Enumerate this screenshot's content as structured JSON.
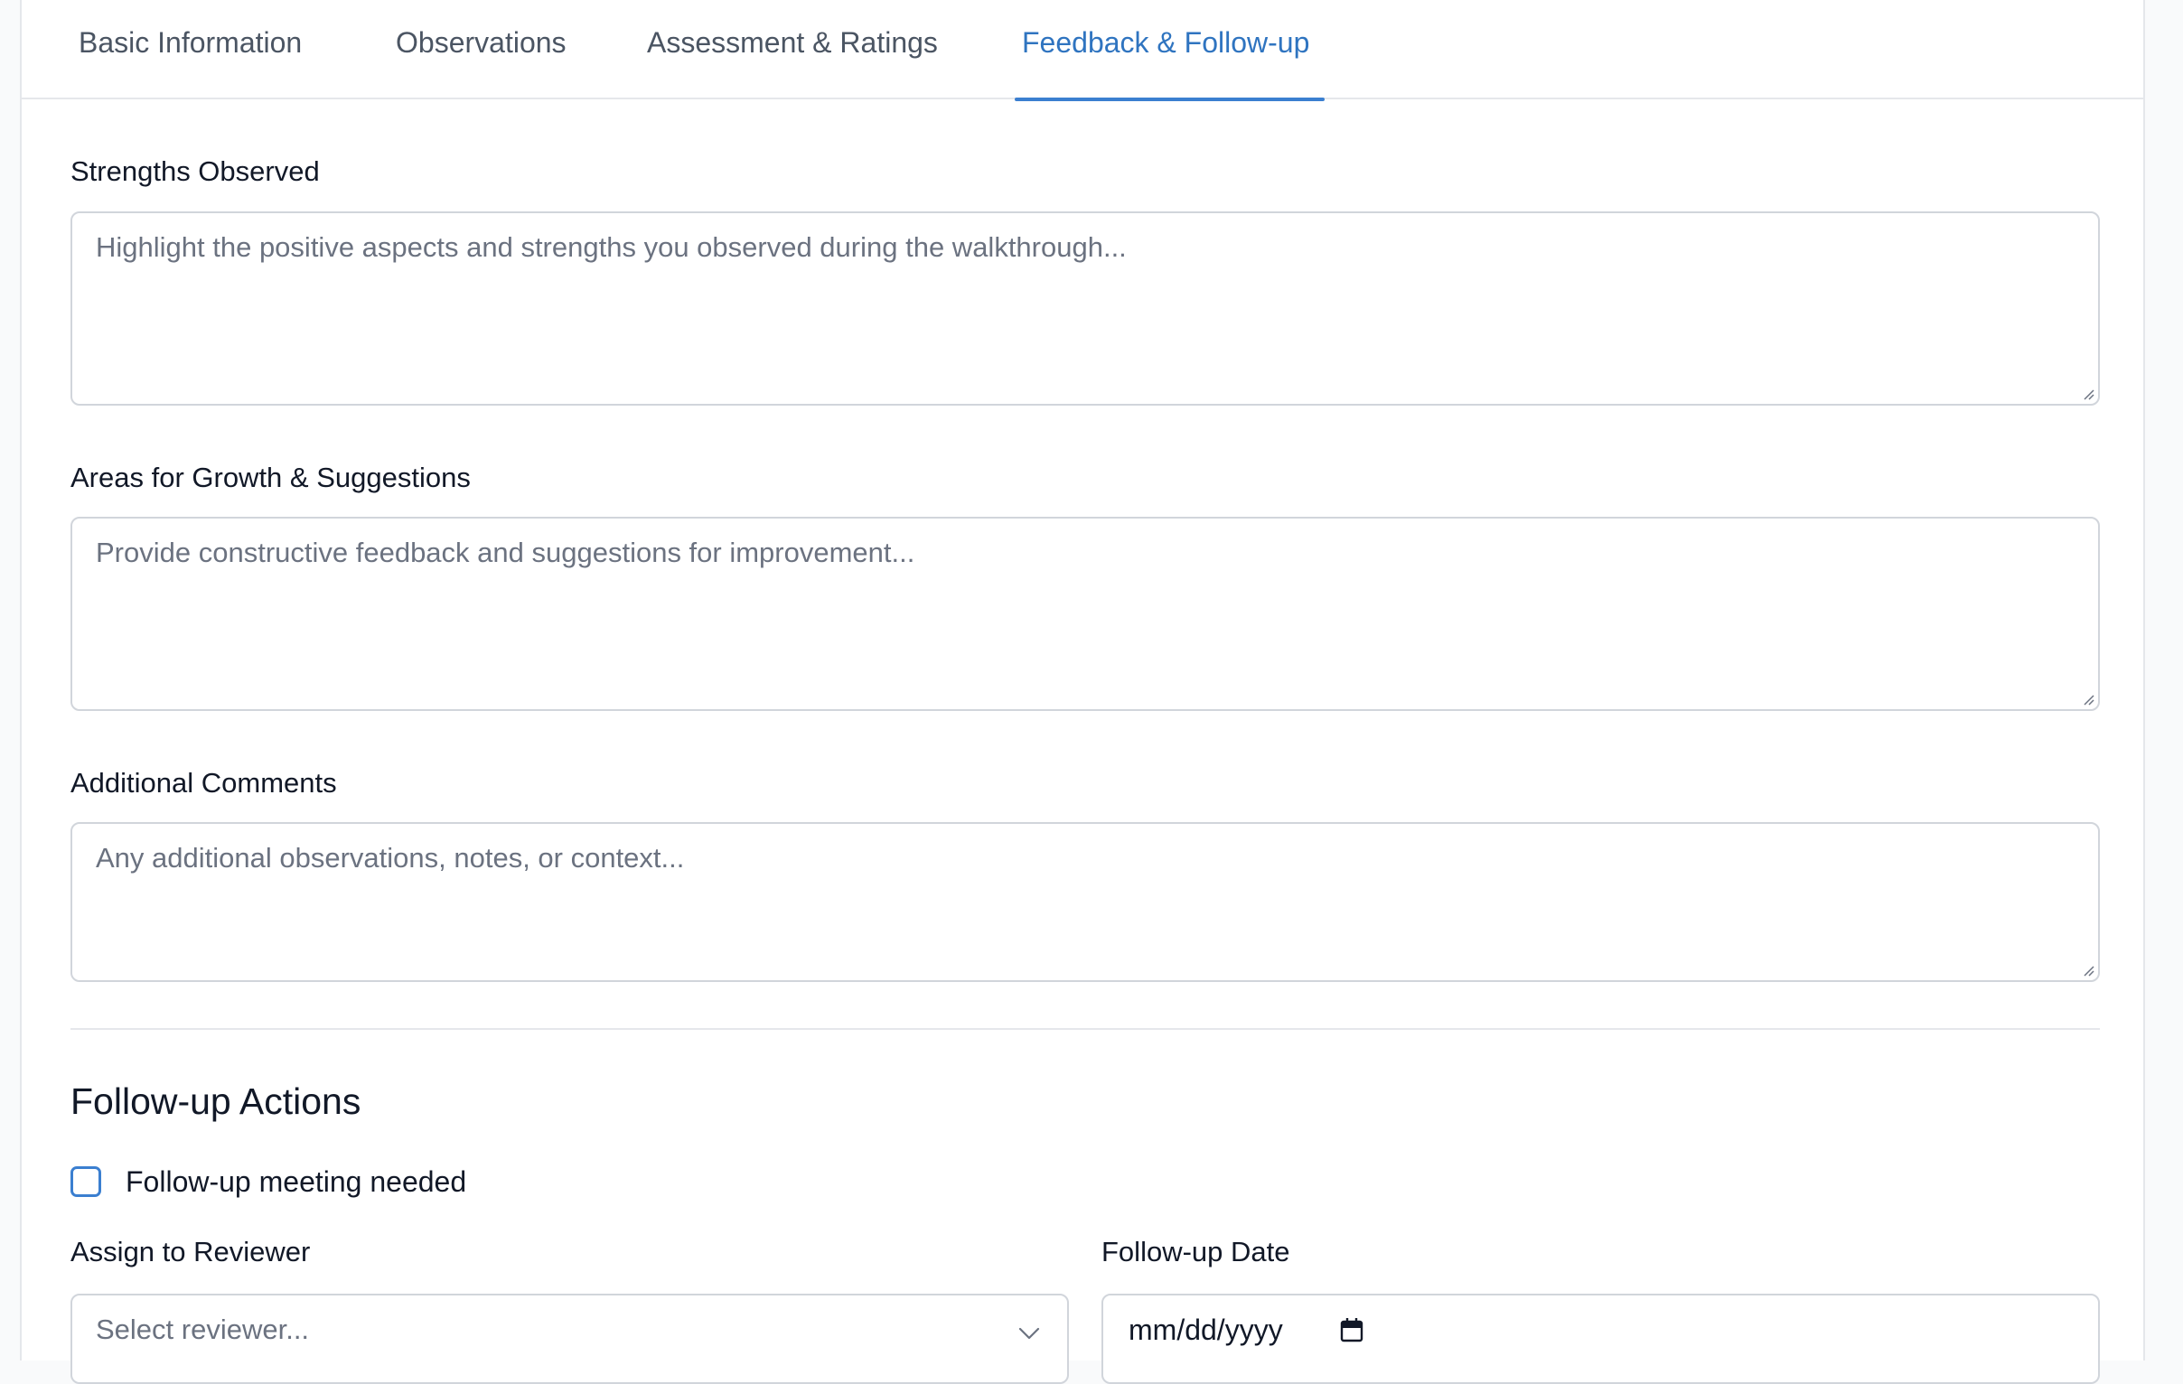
{
  "tabs": [
    {
      "label": "Basic Information",
      "active": false
    },
    {
      "label": "Observations",
      "active": false
    },
    {
      "label": "Assessment & Ratings",
      "active": false
    },
    {
      "label": "Feedback & Follow-up",
      "active": true
    }
  ],
  "strengths": {
    "label": "Strengths Observed",
    "placeholder": "Highlight the positive aspects and strengths you observed during the walkthrough..."
  },
  "growth": {
    "label": "Areas for Growth & Suggestions",
    "placeholder": "Provide constructive feedback and suggestions for improvement..."
  },
  "comments": {
    "label": "Additional Comments",
    "placeholder": "Any additional observations, notes, or context..."
  },
  "followup": {
    "title": "Follow-up Actions",
    "meeting_label": "Follow-up meeting needed",
    "meeting_checked": false,
    "reviewer_label": "Assign to Reviewer",
    "reviewer_placeholder": "Select reviewer...",
    "date_label": "Follow-up Date",
    "date_placeholder": "mm/dd/yyyy"
  },
  "colors": {
    "accent": "#2f74c0",
    "border": "#d1d5db",
    "placeholder": "#6b7280"
  }
}
